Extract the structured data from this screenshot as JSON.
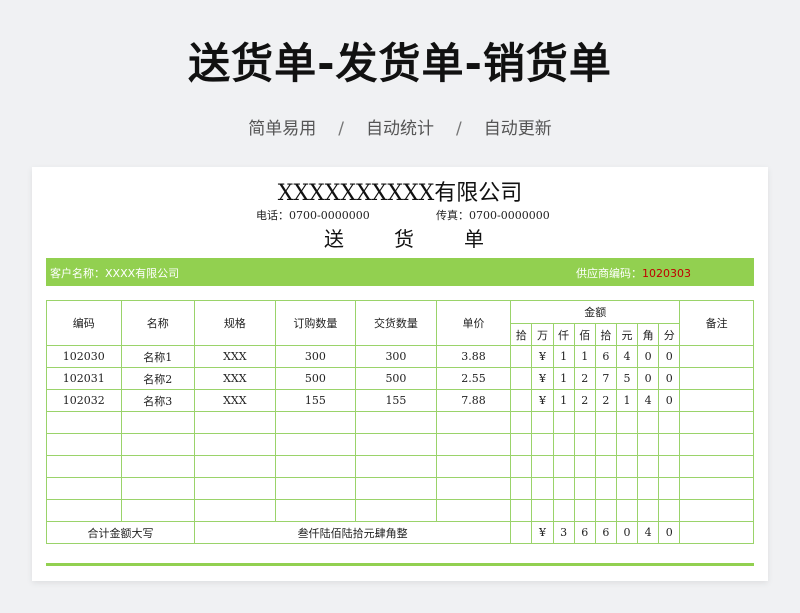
{
  "hero": {
    "title": "送货单-发货单-销货单",
    "features": [
      "简单易用",
      "自动统计",
      "自动更新"
    ],
    "separator": "/"
  },
  "doc": {
    "company": "XXXXXXXXXX有限公司",
    "phone": "电话：0700-0000000",
    "fax": "传真：0700-0000000",
    "title_chars": [
      "送",
      "货",
      "单"
    ],
    "customer": "客户名称：XXXX有限公司",
    "supplier_label": "供应商编码：",
    "supplier_code": "1020303",
    "accent": "#92d050"
  },
  "table": {
    "headers": {
      "code": "编码",
      "name": "名称",
      "spec": "规格",
      "order_qty": "订购数量",
      "deliver_qty": "交货数量",
      "price": "单价",
      "amount": "金额",
      "amount_units": [
        "拾",
        "万",
        "仟",
        "佰",
        "拾",
        "元",
        "角",
        "分"
      ],
      "remark": "备注"
    },
    "rows": [
      {
        "code": "102030",
        "name": "名称1",
        "spec": "XXX",
        "order_qty": "300",
        "deliver_qty": "300",
        "price": "3.88",
        "digits": [
          "",
          "¥",
          "1",
          "1",
          "6",
          "4",
          "0",
          "0"
        ],
        "remark": ""
      },
      {
        "code": "102031",
        "name": "名称2",
        "spec": "XXX",
        "order_qty": "500",
        "deliver_qty": "500",
        "price": "2.55",
        "digits": [
          "",
          "¥",
          "1",
          "2",
          "7",
          "5",
          "0",
          "0"
        ],
        "remark": ""
      },
      {
        "code": "102032",
        "name": "名称3",
        "spec": "XXX",
        "order_qty": "155",
        "deliver_qty": "155",
        "price": "7.88",
        "digits": [
          "",
          "¥",
          "1",
          "2",
          "2",
          "1",
          "4",
          "0"
        ],
        "remark": ""
      },
      {
        "code": "",
        "name": "",
        "spec": "",
        "order_qty": "",
        "deliver_qty": "",
        "price": "",
        "digits": [
          "",
          "",
          "",
          "",
          "",
          "",
          "",
          ""
        ],
        "remark": ""
      },
      {
        "code": "",
        "name": "",
        "spec": "",
        "order_qty": "",
        "deliver_qty": "",
        "price": "",
        "digits": [
          "",
          "",
          "",
          "",
          "",
          "",
          "",
          ""
        ],
        "remark": ""
      },
      {
        "code": "",
        "name": "",
        "spec": "",
        "order_qty": "",
        "deliver_qty": "",
        "price": "",
        "digits": [
          "",
          "",
          "",
          "",
          "",
          "",
          "",
          ""
        ],
        "remark": ""
      },
      {
        "code": "",
        "name": "",
        "spec": "",
        "order_qty": "",
        "deliver_qty": "",
        "price": "",
        "digits": [
          "",
          "",
          "",
          "",
          "",
          "",
          "",
          ""
        ],
        "remark": ""
      },
      {
        "code": "",
        "name": "",
        "spec": "",
        "order_qty": "",
        "deliver_qty": "",
        "price": "",
        "digits": [
          "",
          "",
          "",
          "",
          "",
          "",
          "",
          ""
        ],
        "remark": ""
      }
    ],
    "total": {
      "label": "合计金额大写",
      "words": "叁仟陆佰陆拾元肆角整",
      "digits": [
        "",
        "¥",
        "3",
        "6",
        "6",
        "0",
        "4",
        "0"
      ],
      "remark": ""
    }
  }
}
